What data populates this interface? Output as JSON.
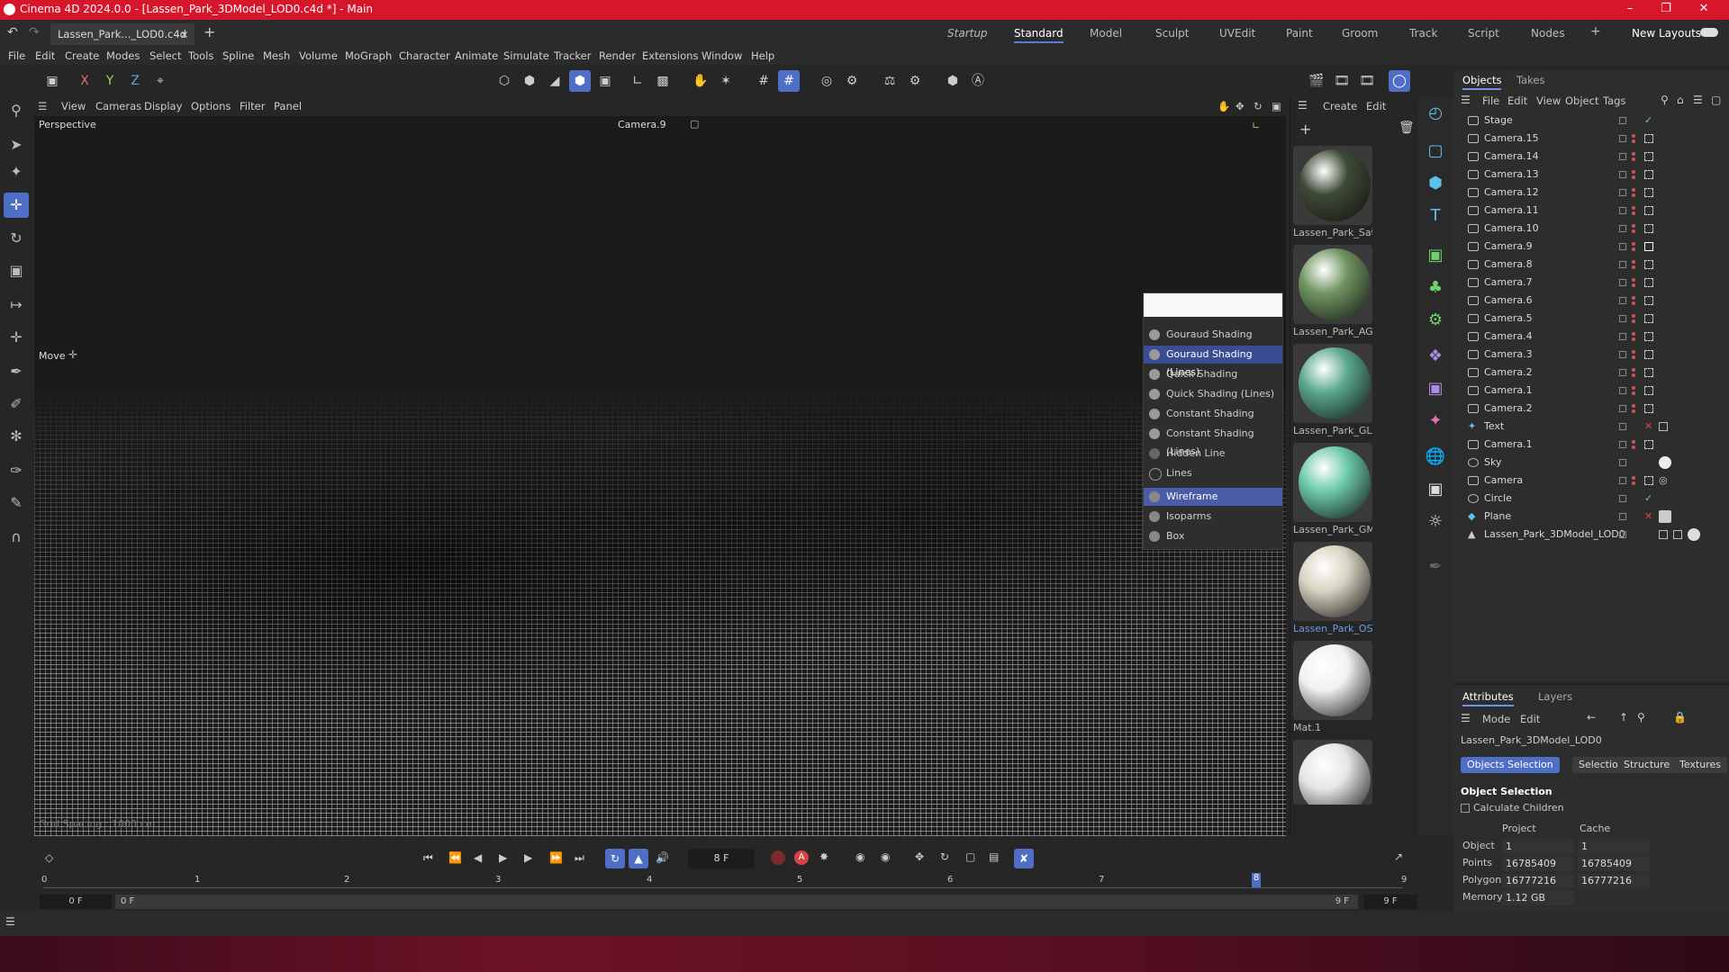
{
  "window": {
    "title": "Cinema 4D 2024.0.0 - [Lassen_Park_3DModel_LOD0.c4d *] - Main"
  },
  "tabs": {
    "doc_tab": "Lassen_Park..._LOD0.c4d *"
  },
  "layouts": [
    "Startup",
    "Standard",
    "Model",
    "Sculpt",
    "UVEdit",
    "Paint",
    "Groom",
    "Track",
    "Script",
    "Nodes"
  ],
  "layouts_active": "Standard",
  "new_layouts": "New Layouts",
  "menubar": [
    "File",
    "Edit",
    "Create",
    "Modes",
    "Select",
    "Tools",
    "Spline",
    "Mesh",
    "Volume",
    "MoGraph",
    "Character",
    "Animate",
    "Simulate",
    "Tracker",
    "Render",
    "Extensions",
    "Window",
    "Help"
  ],
  "axis_toggles": [
    "X",
    "Y",
    "Z"
  ],
  "viewport": {
    "menu": [
      "View",
      "Cameras",
      "Display",
      "Options",
      "Filter",
      "Panel"
    ],
    "label": "Perspective",
    "camera": "Camera.9",
    "tool_label": "Move",
    "footer_left": "Grid Spacing : 1000 cm"
  },
  "shading_menu": {
    "items": [
      "Gouraud Shading",
      "Gouraud Shading (Lines)",
      "Quick Shading",
      "Quick Shading (Lines)",
      "Constant Shading",
      "Constant Shading (Lines)",
      "Hidden Line",
      "Lines",
      "Wireframe",
      "Isoparms",
      "Box"
    ]
  },
  "material_panel": {
    "menu": [
      "Create",
      "Edit"
    ],
    "materials": [
      {
        "name": "Lassen_Park_Satel",
        "color": "#3e4a36"
      },
      {
        "name": "Lassen_Park_AG_L",
        "color": "#6f9460"
      },
      {
        "name": "Lassen_Park_GLan",
        "color": "#5aa88e"
      },
      {
        "name": "Lassen_Park_GMa",
        "color": "#6ccaa9"
      },
      {
        "name": "Lassen_Park_OSM",
        "color": "#d9d4c2"
      },
      {
        "name": "Mat.1",
        "color": "#f2f2f2"
      },
      {
        "name": "",
        "color": "#e6e6e6"
      }
    ]
  },
  "objects_panel": {
    "tabs": [
      "Objects",
      "Takes"
    ],
    "menu": [
      "File",
      "Edit",
      "View",
      "Object",
      "Tags"
    ],
    "items": [
      "Stage",
      "Camera.15",
      "Camera.14",
      "Camera.13",
      "Camera.12",
      "Camera.11",
      "Camera.10",
      "Camera.9",
      "Camera.8",
      "Camera.7",
      "Camera.6",
      "Camera.5",
      "Camera.4",
      "Camera.3",
      "Camera.2",
      "Camera.1",
      "Camera.2",
      "Text",
      "Camera.1",
      "Sky",
      "Camera",
      "Circle",
      "Plane",
      "Lassen_Park_3DModel_LOD0"
    ]
  },
  "attributes_panel": {
    "tabs": [
      "Attributes",
      "Layers"
    ],
    "menu": [
      "Mode",
      "Edit"
    ],
    "object_name": "Lassen_Park_3DModel_LOD0",
    "buttons": [
      "Objects Selection",
      "Selection",
      "Structure",
      "Textures"
    ],
    "section": "Object Selection",
    "checkbox": "Calculate Children",
    "col_headers": [
      "Project",
      "Cache"
    ],
    "rows": [
      {
        "label": "Object",
        "project": "1",
        "cache": "1"
      },
      {
        "label": "Points",
        "project": "16785409",
        "cache": "16785409"
      },
      {
        "label": "Polygons",
        "project": "16777216",
        "cache": "16777216"
      },
      {
        "label": "Memory",
        "project": "1.12 GB",
        "cache": ""
      }
    ]
  },
  "timeline": {
    "current_frame": "8 F",
    "ruler": [
      "0",
      "1",
      "2",
      "3",
      "4",
      "5",
      "6",
      "7",
      "8",
      "9"
    ],
    "start": "0 F",
    "start2": "0 F",
    "end": "9 F",
    "end2": "9 F"
  },
  "colors": {
    "titlebar": "#d8162b",
    "accent": "#4f6fc7",
    "icon_cyan": "#5bc2ea"
  }
}
